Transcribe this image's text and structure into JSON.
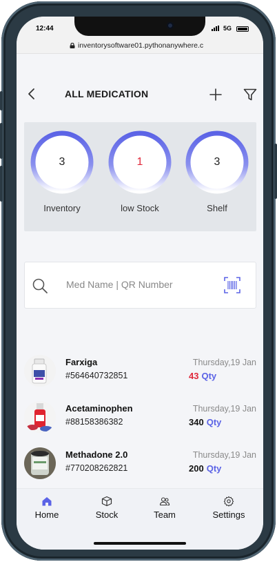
{
  "status_bar": {
    "time": "12:44",
    "network": "5G"
  },
  "browser": {
    "url": "inventorysoftware01.pythonanywhere.c"
  },
  "header": {
    "title": "ALL MEDICATION",
    "back_icon": "chevron-left-icon",
    "add_icon": "plus-icon",
    "filter_icon": "filter-icon"
  },
  "stats": [
    {
      "value": "3",
      "label": "Inventory",
      "value_color": "#222222"
    },
    {
      "value": "1",
      "label": "low Stock",
      "value_color": "#e0283a"
    },
    {
      "value": "3",
      "label": "Shelf",
      "value_color": "#222222"
    }
  ],
  "search": {
    "placeholder": "Med Name | QR Number",
    "icon": "search-icon",
    "scan_icon": "barcode-scan-icon"
  },
  "medications": [
    {
      "name": "Farxiga",
      "code": "#564640732851",
      "date": "Thursday,19 Jan",
      "qty": "43",
      "qty_label": "Qty",
      "low_stock": true
    },
    {
      "name": "Acetaminophen",
      "code": "#88158386382",
      "date": "Thursday,19 Jan",
      "qty": "340",
      "qty_label": "Qty",
      "low_stock": false
    },
    {
      "name": "Methadone 2.0",
      "code": "#770208262821",
      "date": "Thursday,19 Jan",
      "qty": "200",
      "qty_label": "Qty",
      "low_stock": false
    }
  ],
  "bottom_nav": [
    {
      "label": "Home",
      "icon": "home-icon",
      "active": true
    },
    {
      "label": "Stock",
      "icon": "box-icon",
      "active": false
    },
    {
      "label": "Team",
      "icon": "team-icon",
      "active": false
    },
    {
      "label": "Settings",
      "icon": "gear-icon",
      "active": false
    }
  ],
  "colors": {
    "accent": "#5b63e6",
    "low": "#e0283a",
    "ring_top": "#5b63e6",
    "ring_bottom": "#ffffff"
  }
}
